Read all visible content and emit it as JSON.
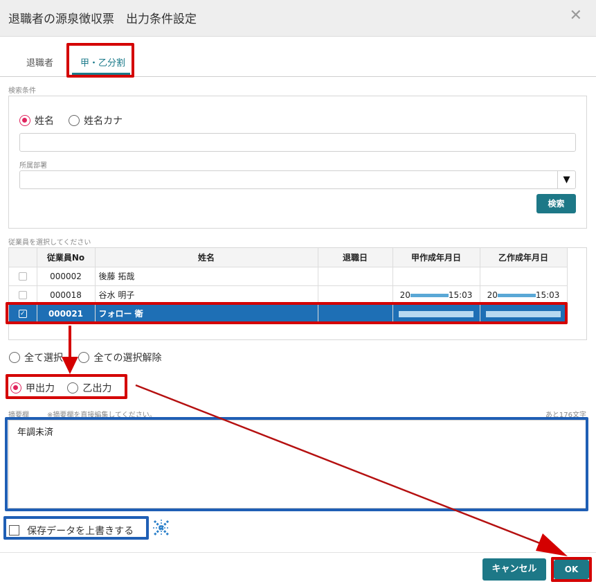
{
  "dialog": {
    "title": "退職者の源泉徴収票　出力条件設定",
    "close_glyph": "✕"
  },
  "tabs": [
    {
      "label": "退職者",
      "active": false
    },
    {
      "label": "甲・乙分割",
      "active": true
    }
  ],
  "search": {
    "section_label": "検索条件",
    "radio_name": "姓名",
    "radio_kana": "姓名カナ",
    "name_value": "",
    "dept_label": "所属部署",
    "dept_value": "",
    "dept_arrow": "▼",
    "search_button": "検索"
  },
  "employees": {
    "section_label": "従業員を選択してください",
    "columns": [
      "",
      "従業員No",
      "姓名",
      "退職日",
      "甲作成年月日",
      "乙作成年月日"
    ],
    "rows": [
      {
        "checked": false,
        "no": "000002",
        "name": "後藤 拓哉",
        "retired": "",
        "kou_prefix": "",
        "kou_time": "",
        "otsu_prefix": "",
        "otsu_time": "",
        "selected": false
      },
      {
        "checked": false,
        "no": "000018",
        "name": "谷水 明子",
        "retired": "",
        "kou_prefix": "20",
        "kou_time": "15:03",
        "otsu_prefix": "20",
        "otsu_time": "15:03",
        "selected": false
      },
      {
        "checked": true,
        "no": "000021",
        "name": "フォロー 衛",
        "retired": "",
        "kou_prefix": "",
        "kou_time": "",
        "otsu_prefix": "",
        "otsu_time": "",
        "selected": true
      }
    ],
    "check_glyph": "✓"
  },
  "selection": {
    "select_all": "全て選択",
    "deselect_all": "全ての選択解除"
  },
  "output": {
    "kou": "甲出力",
    "otsu": "乙出力",
    "selected": "kou"
  },
  "note": {
    "label": "摘要欄",
    "hint": "※摘要欄を直接編集してください。",
    "remaining": "あと176文字",
    "value": "年調未済"
  },
  "overwrite": {
    "label": "保存データを上書きする",
    "checked": false
  },
  "footer": {
    "cancel": "キャンセル",
    "ok": "OK"
  },
  "colors": {
    "accent": "#1d7887",
    "annotation_red": "#d40000",
    "annotation_blue": "#1f5fb5",
    "selected_row": "#1e6fb5"
  }
}
